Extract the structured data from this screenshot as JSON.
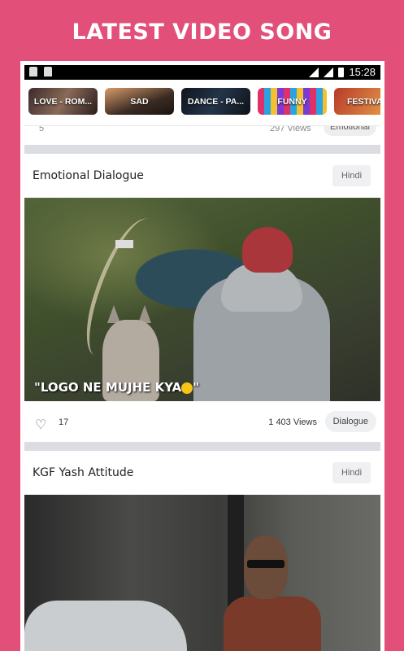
{
  "headline": "LATEST VIDEO SONG",
  "status_bar": {
    "time": "15:28"
  },
  "categories": [
    {
      "label": "LOVE - ROM..."
    },
    {
      "label": "SAD"
    },
    {
      "label": "DANCE - PA..."
    },
    {
      "label": "FUNNY"
    },
    {
      "label": "FESTIVA"
    }
  ],
  "prev_card": {
    "likes": "5",
    "views": "297 Views",
    "tag": "Emotional"
  },
  "cards": [
    {
      "title": "Emotional Dialogue",
      "language": "Hindi",
      "caption": "\"LOGO NE MUJHE KYA",
      "caption_end": "\"",
      "likes": "17",
      "views": "1 403 Views",
      "tag": "Dialogue"
    },
    {
      "title": "KGF Yash Attitude",
      "language": "Hindi"
    }
  ],
  "colors": {
    "background": "#e2507a",
    "card": "#ffffff",
    "divider": "#dcdde3"
  }
}
